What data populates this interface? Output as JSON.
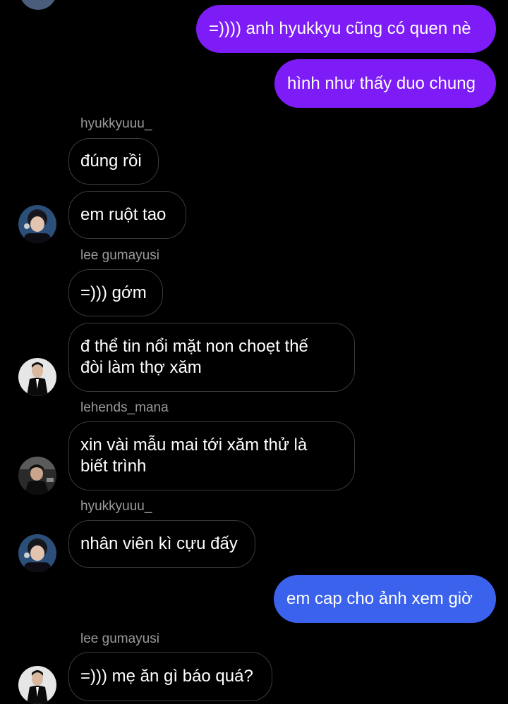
{
  "colors": {
    "background": "#000000",
    "outgoing_purple": "#7d1cf6",
    "outgoing_blue": "#3b62ec",
    "incoming_border": "#3a3a3a",
    "sender_name": "#9a9a9a"
  },
  "messages": [
    {
      "id": "m1",
      "direction": "outgoing",
      "text": "=)))) anh hyukkyu cũng có quen nè"
    },
    {
      "id": "m2",
      "direction": "outgoing",
      "text": "hình như thấy duo chung"
    },
    {
      "id": "s1",
      "sender": "hyukkyuuu_"
    },
    {
      "id": "m3",
      "direction": "incoming",
      "text": "đúng rồi"
    },
    {
      "id": "m4",
      "direction": "incoming",
      "text": "em ruột tao",
      "avatar": "avatar-hyukkyuuu"
    },
    {
      "id": "s2",
      "sender": "lee gumayusi"
    },
    {
      "id": "m5",
      "direction": "incoming",
      "text": "=))) gớm"
    },
    {
      "id": "m6",
      "direction": "incoming",
      "text": "đ thể tin nổi mặt non choẹt thế\nđòi làm thợ xăm",
      "avatar": "avatar-lee-gumayusi"
    },
    {
      "id": "s3",
      "sender": "lehends_mana"
    },
    {
      "id": "m7",
      "direction": "incoming",
      "text": "xin vài mẫu mai tới xăm thử là\nbiết trình",
      "avatar": "avatar-lehends-mana"
    },
    {
      "id": "s4",
      "sender": "hyukkyuuu_"
    },
    {
      "id": "m8",
      "direction": "incoming",
      "text": "nhân viên kì cựu đấy",
      "avatar": "avatar-hyukkyuuu"
    },
    {
      "id": "m9",
      "direction": "outgoing",
      "text": "em cap cho ảnh xem giờ"
    },
    {
      "id": "s5",
      "sender": "lee gumayusi"
    },
    {
      "id": "m10",
      "direction": "incoming",
      "text": "=))) mẹ ăn gì báo quá?",
      "avatar": "avatar-lee-gumayusi"
    }
  ]
}
